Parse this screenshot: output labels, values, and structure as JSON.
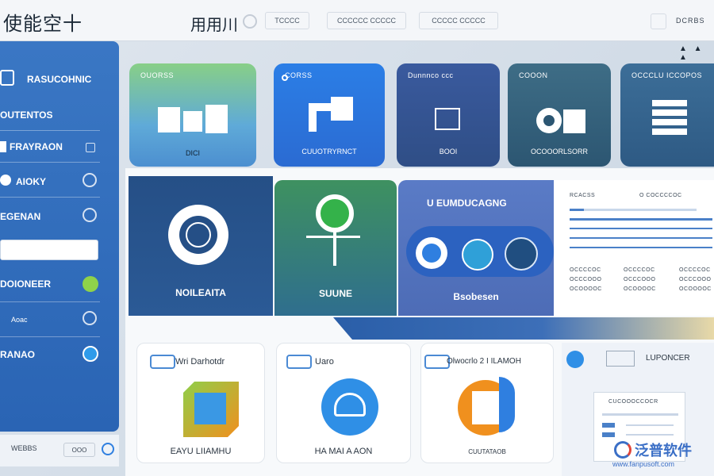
{
  "topbar": {
    "brand": "使能空十",
    "title": "用用川",
    "tabs": [
      "TCCCC",
      "CCCCCC CCCCC",
      "CCCCC CCCCC"
    ],
    "right_label": "DCRBS",
    "tray": "▲ ▲ ▲"
  },
  "sidebar": {
    "header": "RASUCOHNIC",
    "items": [
      {
        "label": "OUTENTOS"
      },
      {
        "label": "FRAYRAON"
      },
      {
        "label": "AIOKY"
      },
      {
        "label": "EGENAN"
      },
      {
        "label": "DOIONEER"
      },
      {
        "label": "Aoac"
      },
      {
        "label": "RANAO"
      }
    ],
    "input_value": "",
    "bottom_left": "WEBBS",
    "bottom_right": "OOO"
  },
  "top_cards": [
    {
      "label": "OUORSS",
      "foot": "DICI"
    },
    {
      "label": "CORSS",
      "foot": "CUUOTRYRNCT"
    },
    {
      "label": "Dunnnco ccc",
      "foot": "BOOI"
    },
    {
      "label": "COOON",
      "foot": "OCOOORLSORR"
    },
    {
      "label": "OCCCLU ICCOPOS",
      "foot": ""
    }
  ],
  "tiles": [
    {
      "label": "NOILEAITA"
    },
    {
      "label": "SUUNE"
    },
    {
      "title": "U EUMDUCAGNG",
      "label": "Bsobesen"
    }
  ],
  "right_panel": {
    "col1": "RCACSS",
    "col2": "O COCCCCOC",
    "rows": [
      "OCCCCOC",
      "OCCCOOO",
      "OCOOOOC"
    ]
  },
  "bottom_cards": [
    {
      "title": "Wri Darhotdr",
      "foot": "EAYU LIIAMHU"
    },
    {
      "title": "Uaro",
      "foot": "HA MAI A AON"
    },
    {
      "title": "Olwocrlo 2 I ILAMOH",
      "foot": "CUUTATAOB"
    }
  ],
  "bottom_right": {
    "title": "LUPONCER",
    "panel_label": "CUCOOOCCOCR"
  },
  "watermark": {
    "brand": "泛普软件",
    "url": "www.fanpusoft.com"
  },
  "colors": {
    "sidebar": "#3a77c4",
    "accent_blue": "#2f7fe0",
    "accent_green": "#8fd24a",
    "dark_navy": "#264d7f",
    "green_tile": "#3d8a5d"
  }
}
